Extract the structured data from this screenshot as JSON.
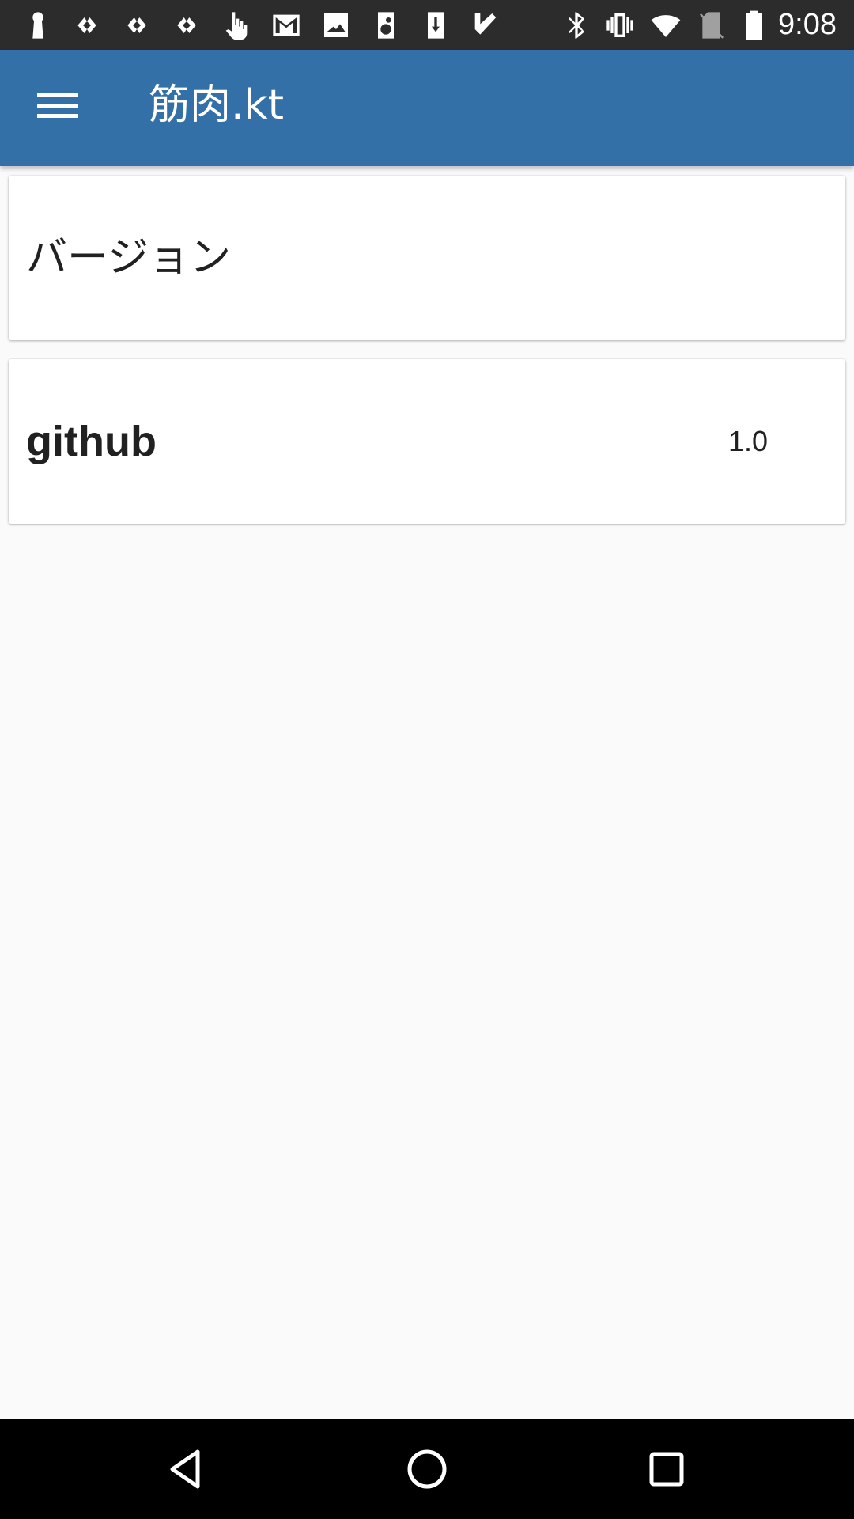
{
  "status_bar": {
    "time": "9:08",
    "left_icons": [
      "keyhole-icon",
      "app-notification-icon",
      "app-notification-icon",
      "app-notification-icon",
      "touch-icon",
      "gmail-icon",
      "image-icon",
      "speaker-icon",
      "download-icon",
      "checkmark-icon"
    ],
    "right_icons": [
      "bluetooth-icon",
      "vibrate-icon",
      "wifi-icon",
      "no-sim-icon",
      "battery-icon"
    ]
  },
  "app_bar": {
    "title": "筋肉.kt",
    "background": "#3470a8",
    "menu_icon": "menu-icon"
  },
  "cards": {
    "version": {
      "label": "バージョン"
    },
    "github": {
      "label": "github",
      "value": "1.0"
    }
  },
  "nav_bar": {
    "buttons": [
      "back-icon",
      "home-icon",
      "recents-icon"
    ]
  }
}
